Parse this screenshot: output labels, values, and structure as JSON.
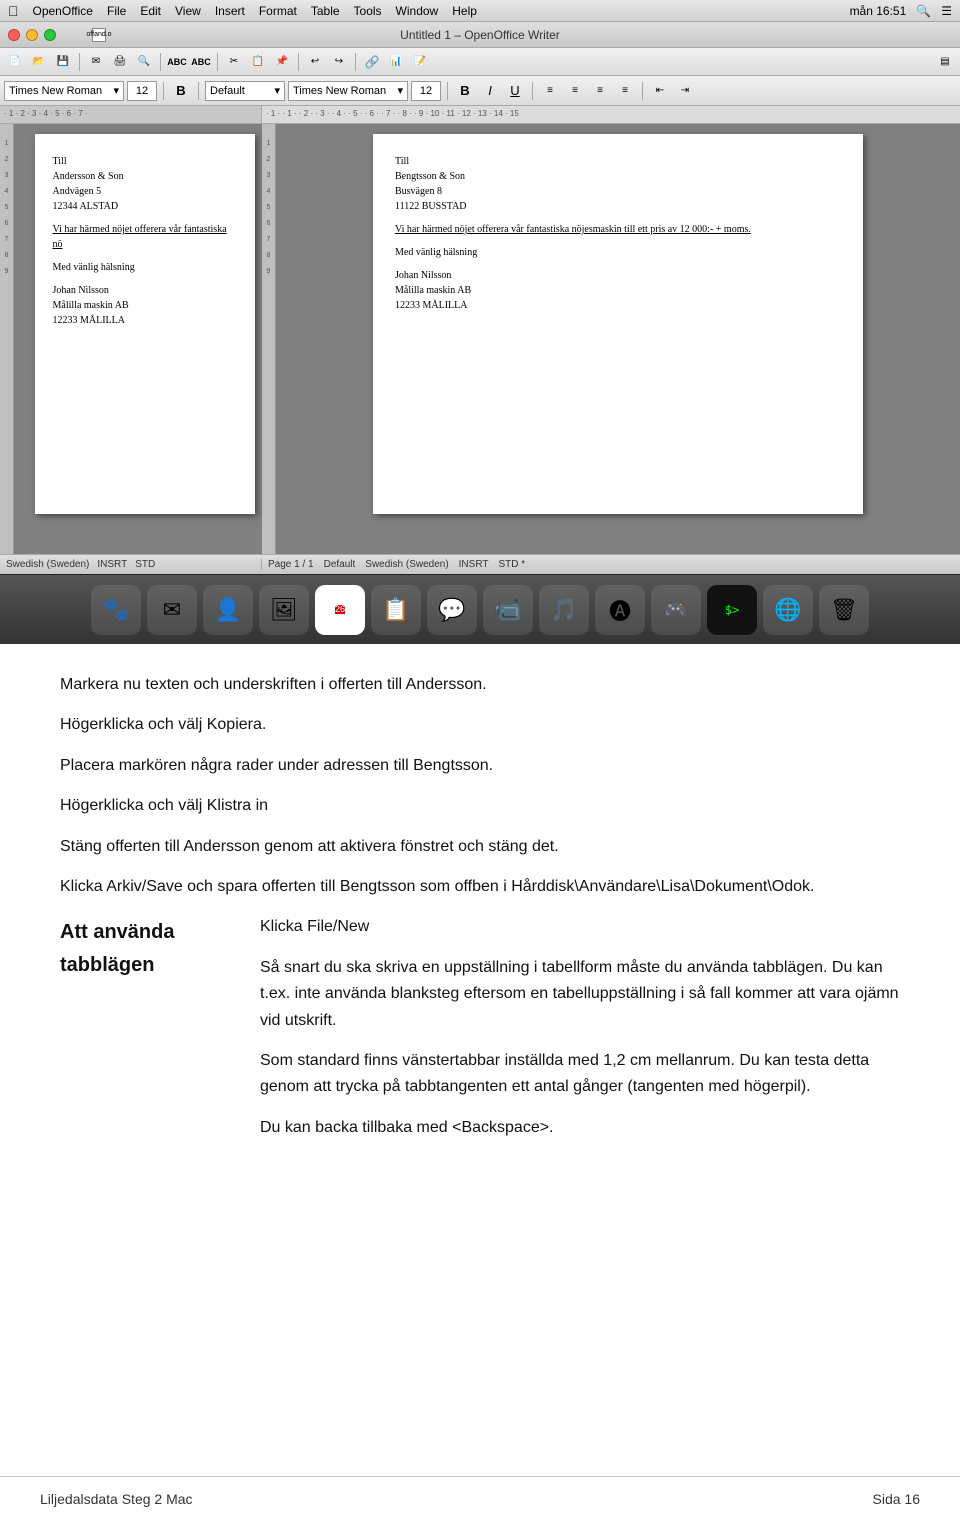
{
  "window": {
    "title": "Untitled 1 – OpenOffice Writer",
    "title_short": "Untitled"
  },
  "menubar": {
    "apple": "⌘",
    "items": [
      "OpenOffice",
      "File",
      "Edit",
      "View",
      "Insert",
      "Format",
      "Table",
      "Tools",
      "Window",
      "Help"
    ],
    "time": "mån 16:51",
    "right_icons": [
      "🔍",
      "☰"
    ]
  },
  "titlebar": {
    "doc_icon_label": "offand.o",
    "full_title": "Untitled 1 – OpenOffice Writer"
  },
  "toolbar1": {
    "buttons": [
      "📄",
      "📂",
      "💾",
      "✉",
      "🖨",
      "🔍",
      "ABC",
      "ABC",
      "|",
      "✂",
      "📋",
      "📌",
      "|",
      "↩",
      "↪",
      "|",
      "🔗",
      "📊",
      "📝"
    ]
  },
  "toolbar2": {
    "font_left": "Times New Roman",
    "size_left": "12",
    "bold_left": "B",
    "font_right_label": "Default",
    "font_right": "Times New Roman",
    "size_right": "12",
    "bold": "B",
    "italic": "I",
    "underline": "U",
    "align_buttons": [
      "≡",
      "≡",
      "≡",
      "≡"
    ],
    "indent_buttons": [
      "⇤",
      "⇥"
    ]
  },
  "statusbar_left": {
    "lang": "Swedish (Sweden)",
    "insert": "INSRT",
    "std": "STD"
  },
  "statusbar_right": {
    "page": "Page 1 / 1",
    "style": "Default",
    "lang": "Swedish (Sweden)",
    "insert": "INSRT",
    "std": "STD *"
  },
  "doc_left": {
    "address_label": "Till",
    "name": "Andersson & Son",
    "street": "Andvägen 5",
    "postal": "12344 ALSTAD",
    "body": "Vi har härmed nöjet offerera vår fantastiska nö",
    "greeting": "Med vänlig hälsning",
    "sig_name": "Johan Nilsson",
    "sig_company": "Målilla maskin AB",
    "sig_postal": "12233 MÅLILLA"
  },
  "doc_right": {
    "address_label": "Till",
    "name": "Bengtsson & Son",
    "street": "Busvägen 8",
    "postal": "11122 BUSSTAD",
    "body": "Vi har härmed nöjet offerera vår fantastiska nöjesmaskin till ett pris av 12 000:- + moms.",
    "greeting": "Med vänlig hälsning",
    "sig_name": "Johan Nilsson",
    "sig_company": "Målilla maskin AB",
    "sig_postal": "12233 MÅLILLA"
  },
  "instructions": [
    "Markera nu texten och underskriften i offerten till Andersson.",
    "Högerklicka och välj Kopiera.",
    "Placera markören några rader under adressen till Bengtsson.",
    "Högerklicka och välj Klistra in",
    "Stäng offerten till Andersson genom att aktivera fönstret och stäng det.",
    "Klicka Arkiv/Save och spara offerten till Bengtsson som offben i Hårddisk\\Användare\\Lisa\\Dokument\\Odok."
  ],
  "section_heading": "Att använda tabblägen",
  "section_intro": "Klicka File/New",
  "section_paragraphs": [
    "Så snart du ska skriva en uppställning i tabellform måste du använda tabblägen. Du kan t.ex. inte använda blanksteg eftersom en tabelluppställning i så fall kommer att vara ojämn vid utskrift.",
    "Som standard finns vänstertabbar inställda med 1,2 cm mellanrum. Du kan testa detta genom att trycka på tabbtangenten ett antal gånger (tangenten med högerpil).",
    "Du kan backa tillbaka med <Backspace>."
  ],
  "footer": {
    "left": "Liljedalsdata Steg 2 Mac",
    "right": "Sida 16"
  }
}
